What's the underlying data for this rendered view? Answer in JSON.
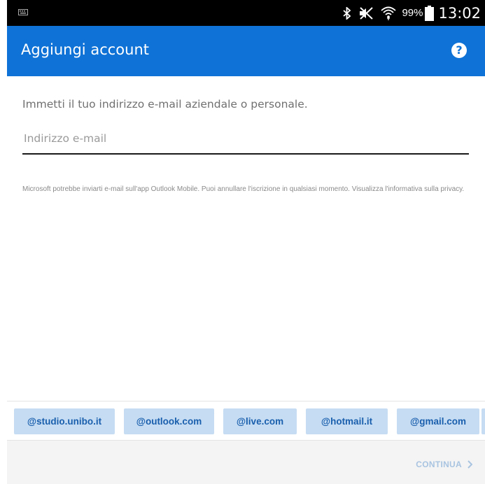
{
  "status_bar": {
    "battery_percent": "99%",
    "time": "13:02",
    "icons": [
      "keyboard-icon",
      "bluetooth-icon",
      "mute-icon",
      "wifi-icon",
      "battery-icon"
    ]
  },
  "app_bar": {
    "title": "Aggiungi account",
    "help_icon": "help-icon",
    "help_glyph": "?",
    "color": "#0f72d6"
  },
  "form": {
    "instruction": "Immetti il tuo indirizzo e-mail aziendale o personale.",
    "email_placeholder": "Indirizzo e-mail",
    "email_value": "",
    "privacy_text": "Microsoft potrebbe inviarti e-mail sull'app Outlook Mobile. Puoi annullare l'iscrizione in qualsiasi momento. Visualizza l'informativa sulla privacy."
  },
  "domain_suggestions": [
    "@studio.unibo.it",
    "@outlook.com",
    "@live.com",
    "@hotmail.it",
    "@gmail.com"
  ],
  "footer": {
    "continue_label": "CONTINUA",
    "continue_icon": "chevron-right-icon"
  }
}
